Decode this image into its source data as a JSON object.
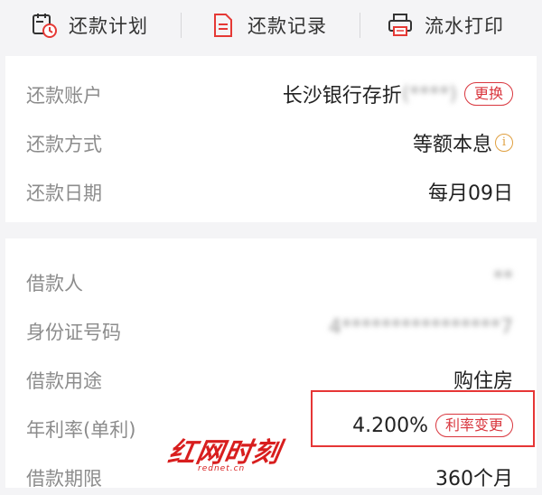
{
  "toolbar": {
    "items": [
      {
        "label": "还款计划",
        "icon": "calendar-clock-icon"
      },
      {
        "label": "还款记录",
        "icon": "document-list-icon"
      },
      {
        "label": "流水打印",
        "icon": "printer-icon"
      }
    ]
  },
  "repayment": {
    "account": {
      "key": "还款账户",
      "value": "长沙银行存折",
      "masked_suffix": "(****)",
      "action": "更换"
    },
    "method": {
      "key": "还款方式",
      "value": "等额本息",
      "info_icon": "info-icon"
    },
    "date": {
      "key": "还款日期",
      "value": "每月09日"
    }
  },
  "loan": {
    "borrower": {
      "key": "借款人",
      "value": "**"
    },
    "id_number": {
      "key": "身份证号码",
      "value": "4****************7"
    },
    "purpose": {
      "key": "借款用途",
      "value": "购住房"
    },
    "rate": {
      "key": "年利率(单利)",
      "value": "4.200%",
      "action": "利率变更"
    },
    "term": {
      "key": "借款期限",
      "value": "360个月"
    }
  },
  "watermark": {
    "text": "红网时刻",
    "sub": "rednet.cn"
  },
  "colors": {
    "accent_red": "#d9363e",
    "info_orange": "#e0a040",
    "background": "#f4f4f6"
  }
}
